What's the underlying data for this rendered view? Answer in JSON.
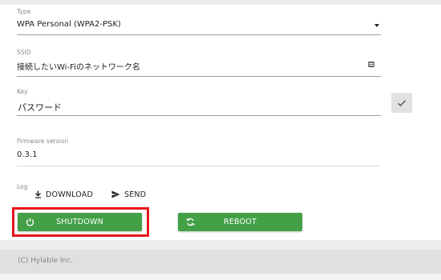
{
  "form": {
    "type": {
      "label": "Type",
      "value": "WPA Personal (WPA2-PSK)"
    },
    "ssid": {
      "label": "SSID",
      "value": "接続したいWi-Fiのネットワーク名"
    },
    "key": {
      "label": "Key",
      "value": "パスワード"
    },
    "firmware": {
      "label": "Firmware version",
      "value": "0.3.1"
    }
  },
  "log": {
    "label": "Log",
    "download_label": "DOWNLOAD",
    "send_label": "SEND"
  },
  "actions": {
    "shutdown_label": "SHUTDOWN",
    "reboot_label": "REBOOT"
  },
  "footer": {
    "copyright": "(C) Hylable Inc."
  },
  "colors": {
    "button_green": "#43a047",
    "highlight_red": "#e8141c"
  }
}
